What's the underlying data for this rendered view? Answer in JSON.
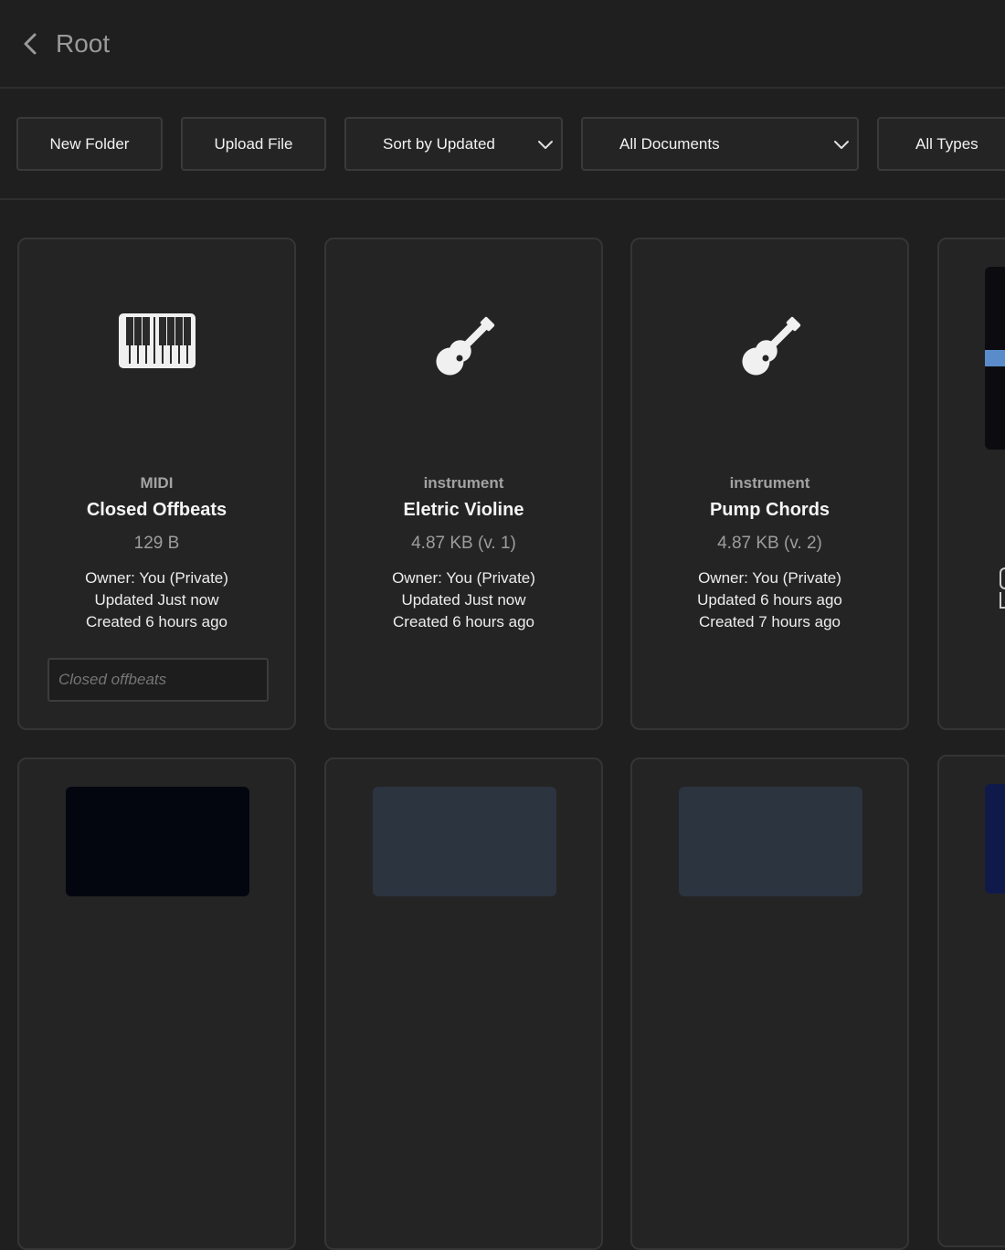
{
  "header": {
    "title": "Root"
  },
  "toolbar": {
    "new_folder": "New Folder",
    "upload_file": "Upload File",
    "sort": "Sort by Updated",
    "documents": "All Documents",
    "types": "All Types"
  },
  "cards": [
    {
      "type": "MIDI",
      "name": "Closed Offbeats",
      "size": "129 B",
      "owner": "Owner: You (Private)",
      "updated": "Updated Just now",
      "created": "Created 6 hours ago",
      "input_placeholder": "Closed offbeats",
      "icon": "piano-icon"
    },
    {
      "type": "instrument",
      "name": "Eletric Violine",
      "size": "4.87 KB (v. 1)",
      "owner": "Owner: You (Private)",
      "updated": "Updated Just now",
      "created": "Created 6 hours ago",
      "icon": "guitar-icon"
    },
    {
      "type": "instrument",
      "name": "Pump Chords",
      "size": "4.87 KB (v. 2)",
      "owner": "Owner: You (Private)",
      "updated": "Updated 6 hours ago",
      "created": "Created 7 hours ago",
      "icon": "guitar-icon"
    }
  ],
  "colors": {
    "background": "#1f1f1f",
    "card": "#242424",
    "border": "#353535",
    "text": "#e8e8e8"
  }
}
